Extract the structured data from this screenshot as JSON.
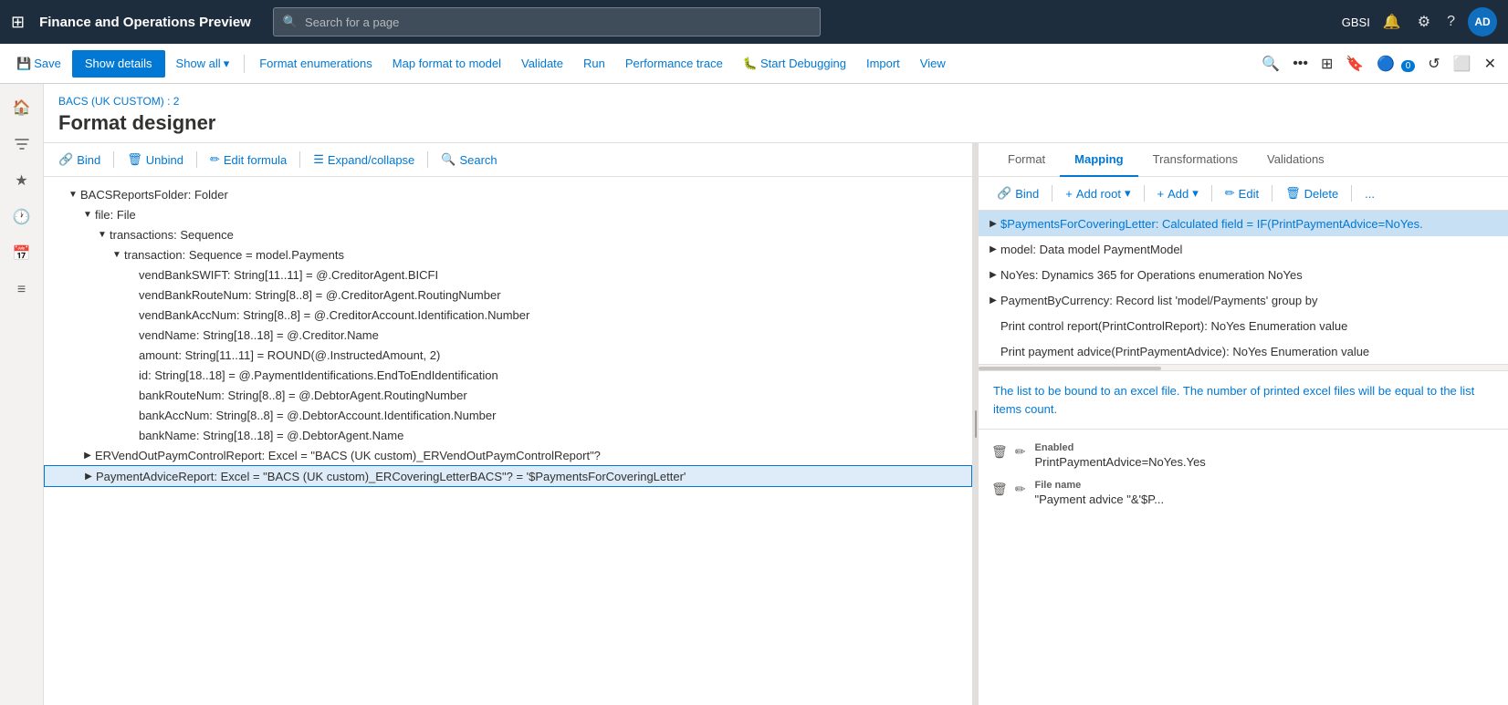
{
  "topNav": {
    "waffle": "⊞",
    "appTitle": "Finance and Operations Preview",
    "searchPlaceholder": "Search for a page",
    "userInitials": "AD",
    "userCode": "GBSI",
    "icons": {
      "bell": "🔔",
      "settings": "⚙",
      "help": "?"
    }
  },
  "toolbar": {
    "saveLabel": "Save",
    "showDetailsLabel": "Show details",
    "showAllLabel": "Show all",
    "formatEnumerationsLabel": "Format enumerations",
    "mapFormatToModelLabel": "Map format to model",
    "validateLabel": "Validate",
    "runLabel": "Run",
    "performanceTraceLabel": "Performance trace",
    "startDebuggingLabel": "Start Debugging",
    "importLabel": "Import",
    "viewLabel": "View"
  },
  "pageHeader": {
    "breadcrumb": "BACS (UK CUSTOM) : 2",
    "title": "Format designer"
  },
  "leftToolbar": {
    "bindLabel": "Bind",
    "unbindLabel": "Unbind",
    "editFormulaLabel": "Edit formula",
    "expandCollapseLabel": "Expand/collapse",
    "searchLabel": "Search"
  },
  "treeItems": [
    {
      "indent": 1,
      "expand": "▼",
      "text": "BACSReportsFolder: Folder",
      "selected": false
    },
    {
      "indent": 2,
      "expand": "▼",
      "text": "file: File",
      "selected": false
    },
    {
      "indent": 3,
      "expand": "▼",
      "text": "transactions: Sequence",
      "selected": false
    },
    {
      "indent": 4,
      "expand": "▼",
      "text": "transaction: Sequence = model.Payments",
      "selected": false
    },
    {
      "indent": 5,
      "expand": "",
      "text": "vendBankSWIFT: String[11..11] = @.CreditorAgent.BICFI",
      "selected": false
    },
    {
      "indent": 5,
      "expand": "",
      "text": "vendBankRouteNum: String[8..8] = @.CreditorAgent.RoutingNumber",
      "selected": false
    },
    {
      "indent": 5,
      "expand": "",
      "text": "vendBankAccNum: String[8..8] = @.CreditorAccount.Identification.Number",
      "selected": false
    },
    {
      "indent": 5,
      "expand": "",
      "text": "vendName: String[18..18] = @.Creditor.Name",
      "selected": false
    },
    {
      "indent": 5,
      "expand": "",
      "text": "amount: String[11..11] = ROUND(@.InstructedAmount, 2)",
      "selected": false
    },
    {
      "indent": 5,
      "expand": "",
      "text": "id: String[18..18] = @.PaymentIdentifications.EndToEndIdentification",
      "selected": false
    },
    {
      "indent": 5,
      "expand": "",
      "text": "bankRouteNum: String[8..8] = @.DebtorAgent.RoutingNumber",
      "selected": false
    },
    {
      "indent": 5,
      "expand": "",
      "text": "bankAccNum: String[8..8] = @.DebtorAccount.Identification.Number",
      "selected": false
    },
    {
      "indent": 5,
      "expand": "",
      "text": "bankName: String[18..18] = @.DebtorAgent.Name",
      "selected": false
    },
    {
      "indent": 2,
      "expand": "▶",
      "text": "ERVendOutPaymControlReport: Excel = \"BACS (UK custom)_ERVendOutPaymControlReport\"?",
      "selected": false
    },
    {
      "indent": 2,
      "expand": "▶",
      "text": "PaymentAdviceReport: Excel = \"BACS (UK custom)_ERCoveringLetterBACS\"? = '$PaymentsForCoveringLetter'",
      "selected": true
    }
  ],
  "rightPanel": {
    "tabs": [
      {
        "id": "format",
        "label": "Format",
        "active": false
      },
      {
        "id": "mapping",
        "label": "Mapping",
        "active": true
      },
      {
        "id": "transformations",
        "label": "Transformations",
        "active": false
      },
      {
        "id": "validations",
        "label": "Validations",
        "active": false
      }
    ],
    "toolbar": {
      "bindLabel": "Bind",
      "addRootLabel": "Add root",
      "addLabel": "Add",
      "editLabel": "Edit",
      "deleteLabel": "Delete",
      "moreLabel": "..."
    },
    "treeItems": [
      {
        "indent": 0,
        "expand": "▶",
        "text": "$PaymentsForCoveringLetter: Calculated field = IF(PrintPaymentAdvice=NoYes.",
        "highlighted": true
      },
      {
        "indent": 0,
        "expand": "▶",
        "text": "model: Data model PaymentModel",
        "highlighted": false
      },
      {
        "indent": 0,
        "expand": "▶",
        "text": "NoYes: Dynamics 365 for Operations enumeration NoYes",
        "highlighted": false
      },
      {
        "indent": 0,
        "expand": "▶",
        "text": "PaymentByCurrency: Record list 'model/Payments' group by",
        "highlighted": false
      },
      {
        "indent": 0,
        "expand": "",
        "text": "Print control report(PrintControlReport): NoYes Enumeration value",
        "highlighted": false
      },
      {
        "indent": 0,
        "expand": "",
        "text": "Print payment advice(PrintPaymentAdvice): NoYes Enumeration value",
        "highlighted": false
      }
    ],
    "infoText": "The list to be bound to an excel file. The number of printed excel files will be equal to the list items count.",
    "properties": [
      {
        "label": "Enabled",
        "value": "PrintPaymentAdvice=NoYes.Yes"
      },
      {
        "label": "File name",
        "value": "\"Payment advice \"&'$P..."
      }
    ]
  },
  "leftSidebar": {
    "icons": [
      "🏠",
      "★",
      "🕐",
      "📅",
      "≡"
    ]
  }
}
